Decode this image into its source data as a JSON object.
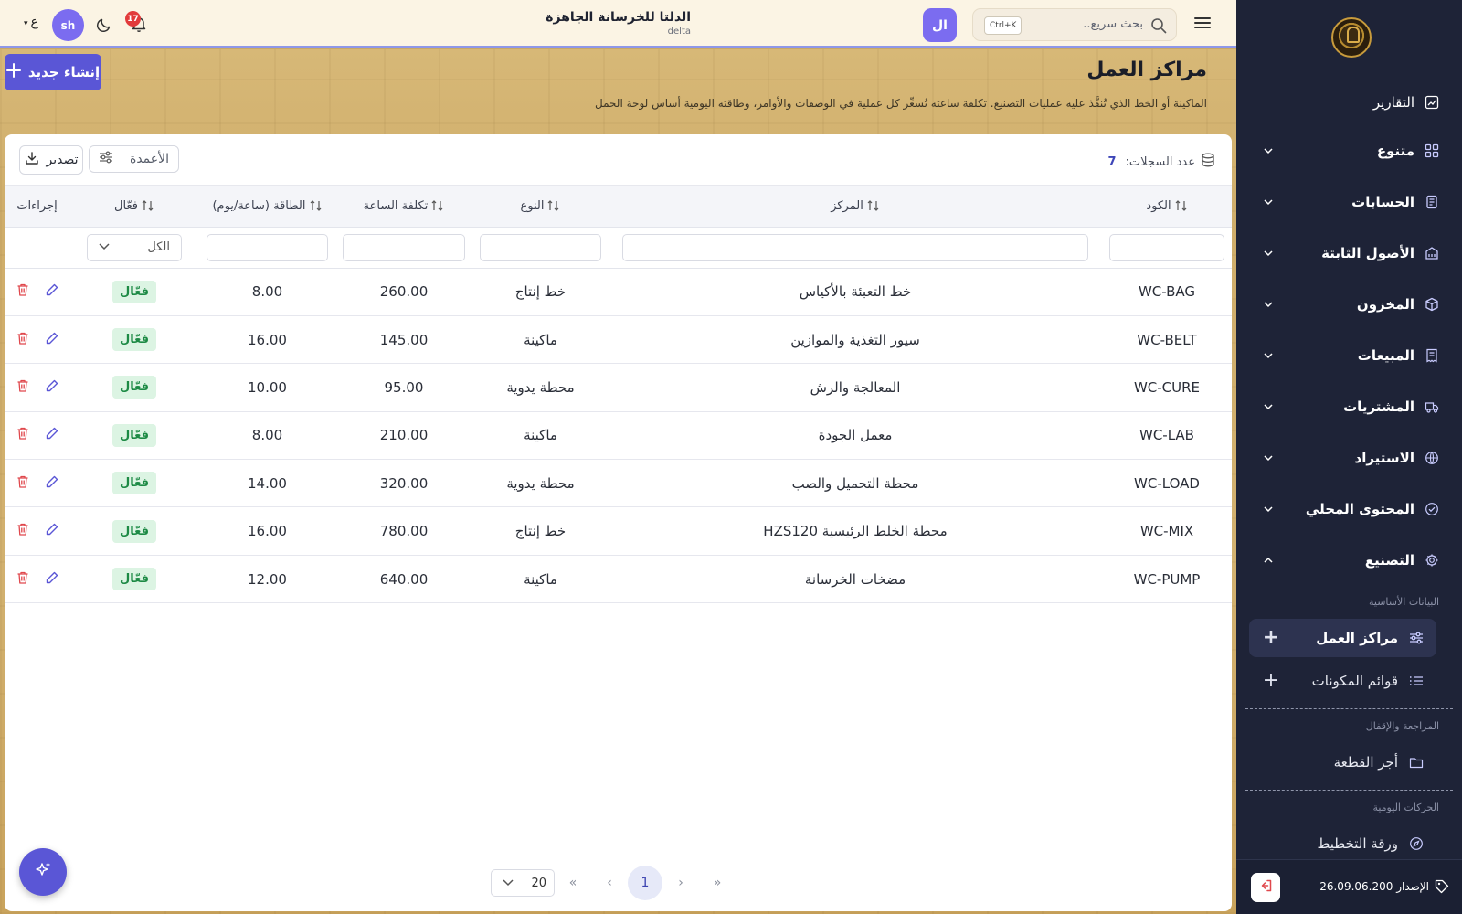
{
  "topbar": {
    "search_placeholder": "بحث سريع..",
    "search_shortcut": "Ctrl+K",
    "org_initials": "ال",
    "org_name": "الدلتا للخرسانة الجاهزة",
    "org_code": "delta",
    "notifications_count": "17",
    "user_initials": "sh",
    "language": "ع"
  },
  "page": {
    "title": "مراكز العمل",
    "description": "الماكينة أو الخط الذي تُنفَّذ عليه عمليات التصنيع. تكلفة ساعته تُسعِّر كل عملية في الوصفات والأوامر، وطاقته اليومية أساس لوحة الحمل",
    "create_label": "إنشاء جديد"
  },
  "toolbar": {
    "records_label": "عدد السجلات:",
    "records_count": "7",
    "columns_label": "الأعمدة",
    "export_label": "تصدير"
  },
  "table": {
    "headers": {
      "code": "الكود",
      "center": "المركز",
      "type": "النوع",
      "hour_cost": "تكلفة الساعة",
      "capacity": "الطاقة (ساعة/يوم)",
      "active": "فعّال",
      "actions": "إجراءات"
    },
    "filter_active_value": "الكل",
    "rows": [
      {
        "code": "WC-BAG",
        "center": "خط التعبئة بالأكياس",
        "type": "خط إنتاج",
        "hour_cost": "260.00",
        "capacity": "8.00",
        "status": "فعّال"
      },
      {
        "code": "WC-BELT",
        "center": "سيور التغذية والموازين",
        "type": "ماكينة",
        "hour_cost": "145.00",
        "capacity": "16.00",
        "status": "فعّال"
      },
      {
        "code": "WC-CURE",
        "center": "المعالجة والرش",
        "type": "محطة يدوية",
        "hour_cost": "95.00",
        "capacity": "10.00",
        "status": "فعّال"
      },
      {
        "code": "WC-LAB",
        "center": "معمل الجودة",
        "type": "ماكينة",
        "hour_cost": "210.00",
        "capacity": "8.00",
        "status": "فعّال"
      },
      {
        "code": "WC-LOAD",
        "center": "محطة التحميل والصب",
        "type": "محطة يدوية",
        "hour_cost": "320.00",
        "capacity": "14.00",
        "status": "فعّال"
      },
      {
        "code": "WC-MIX",
        "center": "محطة الخلط الرئيسية HZS120",
        "type": "خط إنتاج",
        "hour_cost": "780.00",
        "capacity": "16.00",
        "status": "فعّال"
      },
      {
        "code": "WC-PUMP",
        "center": "مضخات الخرسانة",
        "type": "ماكينة",
        "hour_cost": "640.00",
        "capacity": "12.00",
        "status": "فعّال"
      }
    ]
  },
  "pagination": {
    "current_page": "1",
    "page_size": "20"
  },
  "sidebar": {
    "reports": "التقارير",
    "sections": {
      "misc": "متنوع",
      "accounts": "الحسابات",
      "fixed_assets": "الأصول الثابتة",
      "inventory": "المخزون",
      "sales": "المبيعات",
      "purchases": "المشتريات",
      "import": "الاستيراد",
      "local_content": "المحتوى المحلي",
      "manufacturing": "التصنيع"
    },
    "group_master": "البيانات الأساسية",
    "work_centers": "مراكز العمل",
    "bom": "قوائم المكونات",
    "group_review": "المراجعة والإقفال",
    "piece_wage": "أجر القطعة",
    "group_daily": "الحركات اليومية",
    "planning_sheet": "ورقة التخطيط",
    "version_label": "الإصدار",
    "version_value": "26.09.06.200"
  },
  "colors": {
    "sidebar_bg": "#1e2337",
    "accent": "#5a56d6",
    "status_bg": "#dcf4e3",
    "status_text": "#1d8a45",
    "delete": "#e0484d",
    "edit": "#5a56d6"
  }
}
